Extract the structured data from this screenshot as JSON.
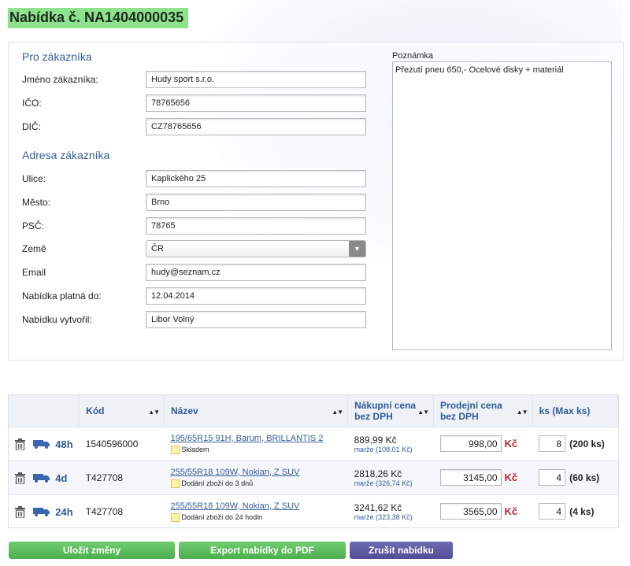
{
  "page_title": "Nabídka č. NA1404000035",
  "customer": {
    "heading": "Pro zákazníka",
    "name_label": "Jméno zákazníka:",
    "name_value": "Hudy sport s.r.o.",
    "ico_label": "IČO:",
    "ico_value": "78765656",
    "dic_label": "DIČ:",
    "dic_value": "CZ78765656"
  },
  "address": {
    "heading": "Adresa zákazníka",
    "street_label": "Ulice:",
    "street_value": "Kaplického 25",
    "city_label": "Město:",
    "city_value": "Brno",
    "zip_label": "PSČ:",
    "zip_value": "78765",
    "country_label": "Země",
    "country_value": "ČR",
    "email_label": "Email",
    "email_value": "hudy@seznam.cz",
    "valid_label": "Nabídka platná do:",
    "valid_value": "12.04.2014",
    "author_label": "Nabídku vytvořil:",
    "author_value": "Libor Volný"
  },
  "note": {
    "label": "Poznámka",
    "value": "Přezutí pneu 650,- Ocelové disky + materiál"
  },
  "table": {
    "headers": {
      "code": "Kód",
      "name": "Název",
      "buy_price_1": "Nákupní cena",
      "buy_price_2": "bez DPH",
      "sell_price_1": "Prodejní cena",
      "sell_price_2": "bez DPH",
      "qty": "ks (Max ks)"
    },
    "sort_glyph": "▲▼",
    "rows": [
      {
        "eta": "48h",
        "code": "1540596000",
        "name": "195/65R15 91H, Barum, BRILLANTIS 2",
        "availability": "Skladem",
        "buy_price": "889,99 Kč",
        "margin": "marže (108,01 Kč)",
        "sell_price": "998,00",
        "currency": "Kč",
        "qty": "8",
        "max": "(200 ks)"
      },
      {
        "eta": "4d",
        "code": "T427708",
        "name": "255/55R18 109W, Nokian, Z SUV",
        "availability": "Dodání zboží do 3 dnů",
        "buy_price": "2818,26 Kč",
        "margin": "marže (326,74 Kč)",
        "sell_price": "3145,00",
        "currency": "Kč",
        "qty": "4",
        "max": "(60 ks)"
      },
      {
        "eta": "24h",
        "code": "T427708",
        "name": "255/55R18 109W, Nokian, Z SUV",
        "availability": "Dodání zboží do 24 hodin",
        "buy_price": "3241,62 Kč",
        "margin": "marže (323,38 Kč)",
        "sell_price": "3565,00",
        "currency": "Kč",
        "qty": "4",
        "max": "(4 ks)"
      }
    ]
  },
  "buttons": {
    "save": "Uložit změny",
    "export": "Export nabídky do PDF",
    "cancel": "Zrušit nabídku"
  },
  "colors": {
    "title_bg": "#8ee28e",
    "heading": "#36609a",
    "accent_green": "#4eae4e",
    "accent_purple": "#524e96",
    "currency_red": "#c0262a"
  }
}
